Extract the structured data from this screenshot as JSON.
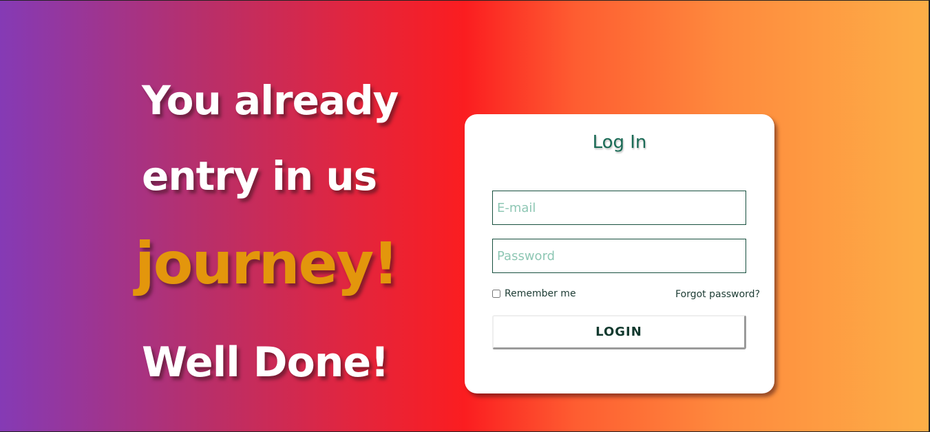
{
  "hero": {
    "line1": "You already",
    "line2": "entry in us",
    "line3": "journey!",
    "line4": "Well Done!"
  },
  "login_card": {
    "title": "Log In",
    "email_placeholder": "E-mail",
    "email_value": "",
    "password_placeholder": "Password",
    "password_value": "",
    "remember_label": "Remember me",
    "remember_checked": false,
    "forgot_label": "Forgot password?",
    "login_label": "LOGIN"
  },
  "colors": {
    "gradient_start": "#853ab5",
    "gradient_mid": "#fb1d20",
    "gradient_end": "#fdae47",
    "accent_word": "#e3960c",
    "card_text": "#1b6b56"
  }
}
